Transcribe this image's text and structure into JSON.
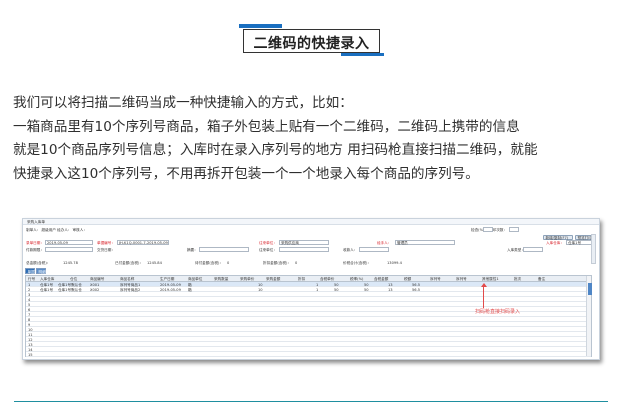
{
  "title": "二维码的快捷录入",
  "paragraph": [
    "我们可以将扫描二维码当成一种快捷输入的方式，比如：",
    "一箱商品里有10个序列号商品，箱子外包装上贴有一个二维码，二维码上携带的信息",
    "就是10个商品序列号信息；入库时在录入序列号的地方 用扫码枪直接扫描二维码，就能",
    "快捷录入这10个序列号，不用再拆开包装一个一个地录入每个商品的序列号。"
  ],
  "screenshot": {
    "window_title": "采购入库单",
    "row1": {
      "left": "制单人：  超级用户      经办人：            审核人：",
      "right": "检查(%)：  打印次数：",
      "ops_button": "新增/复制(F7)",
      "print_button": "预览打印"
    },
    "row2": {
      "date_label": "录单日期：",
      "date_value": "2019-05-09",
      "order_label": "单据编号：",
      "order_value": "JH-K1Q-0001-7-2019-05-09",
      "shipper_label": "往来单位：",
      "shipper_value": "采购供应商",
      "dept_label": "经手人：",
      "dept_value": "管理员",
      "warehouse_label": "入库仓库：",
      "warehouse_value": "仓库1号"
    },
    "row3": {
      "label1": "付款期限：",
      "label2": "交货日期：",
      "label3": "摘要：",
      "label4": "往来单位：",
      "label5": "收款人：",
      "label6": "入库类型："
    },
    "row4": {
      "amount_label": "总金额(含税)：",
      "amount_value": "1245.78",
      "paid_label": "已付金额(含税)：",
      "paid_value": "1245.84",
      "pending_label": "待付金额(含税)：",
      "pending_value": "0",
      "rebate_label": "折扣金额(含税)：",
      "rebate_value": "0",
      "total_label": "价税合计(含税)：",
      "total_value": "13099.4"
    },
    "tabs": [
      "单据",
      "明细"
    ],
    "columns": [
      "行号",
      "入库仓库",
      "仓位",
      "商品编号",
      "商品名称",
      "生产日期",
      "商品单位",
      "采购数量",
      "采购单价",
      "采购金额",
      "折扣",
      "含税单价",
      "税率(%)",
      "含税金额",
      "税额",
      "序列号",
      "序列号",
      "其他属性1",
      "批次",
      "备注"
    ],
    "rows": [
      [
        "1",
        "仓库1号",
        "仓库1号默认仓",
        "X001",
        "序列号商品1",
        "2019-05-09",
        "箱",
        "10",
        "50",
        "1",
        "50",
        "13",
        "56.5"
      ],
      [
        "2",
        "仓库1号",
        "仓库1号默认仓",
        "X002",
        "序列号商品2",
        "2019-05-09",
        "箱",
        "10",
        "50",
        "1",
        "50",
        "13",
        "56.5"
      ],
      [
        "3"
      ],
      [
        "4"
      ],
      [
        "5"
      ],
      [
        "6"
      ],
      [
        "7"
      ],
      [
        "8"
      ],
      [
        "9"
      ],
      [
        "10"
      ],
      [
        "11"
      ],
      [
        "12"
      ],
      [
        "13"
      ],
      [
        "14"
      ],
      [
        "15"
      ],
      [
        "16"
      ]
    ],
    "annotation": "扫码枪直接扫码录入"
  }
}
